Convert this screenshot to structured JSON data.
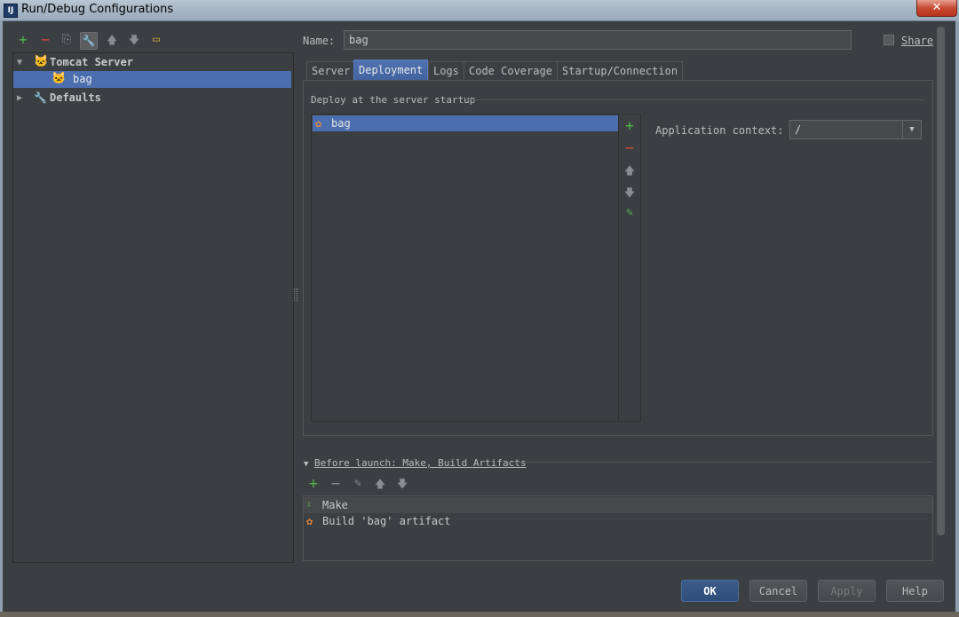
{
  "window": {
    "title": "Run/Debug Configurations",
    "close": "✕",
    "app_icon": "IJ"
  },
  "toolbar": {
    "add": "+",
    "remove": "−",
    "copy": "⎘",
    "edit_defaults": "🔧",
    "move_up": "🡅",
    "move_down": "🡇",
    "folder": "▭"
  },
  "tree": {
    "items": [
      {
        "label": "Tomcat Server",
        "expanded": true
      },
      {
        "label": "bag",
        "selected": true
      },
      {
        "label": "Defaults",
        "expanded": false
      }
    ]
  },
  "name": {
    "label": "Name:",
    "value": "bag"
  },
  "share": {
    "label": "Share",
    "checked": false
  },
  "tabs": [
    {
      "label": "Server",
      "active": false
    },
    {
      "label": "Deployment",
      "active": true
    },
    {
      "label": "Logs",
      "active": false
    },
    {
      "label": "Code Coverage",
      "active": false
    },
    {
      "label": "Startup/Connection",
      "active": false
    }
  ],
  "deployment": {
    "group_title": "Deploy at the server startup",
    "items": [
      {
        "label": "bag",
        "selected": true
      }
    ],
    "app_context_label": "Application context:",
    "app_context_value": "/"
  },
  "before_launch": {
    "title": "Before launch: Make, Build Artifacts",
    "items": [
      {
        "label": "Make",
        "selected": true
      },
      {
        "label": "Build 'bag' artifact",
        "selected": false
      }
    ]
  },
  "buttons": {
    "ok": "OK",
    "cancel": "Cancel",
    "apply": "Apply",
    "help": "Help"
  },
  "colors": {
    "background": "#3c3f41",
    "selection": "#4b6eaf",
    "add": "#4fb34f",
    "remove": "#d9443b"
  }
}
